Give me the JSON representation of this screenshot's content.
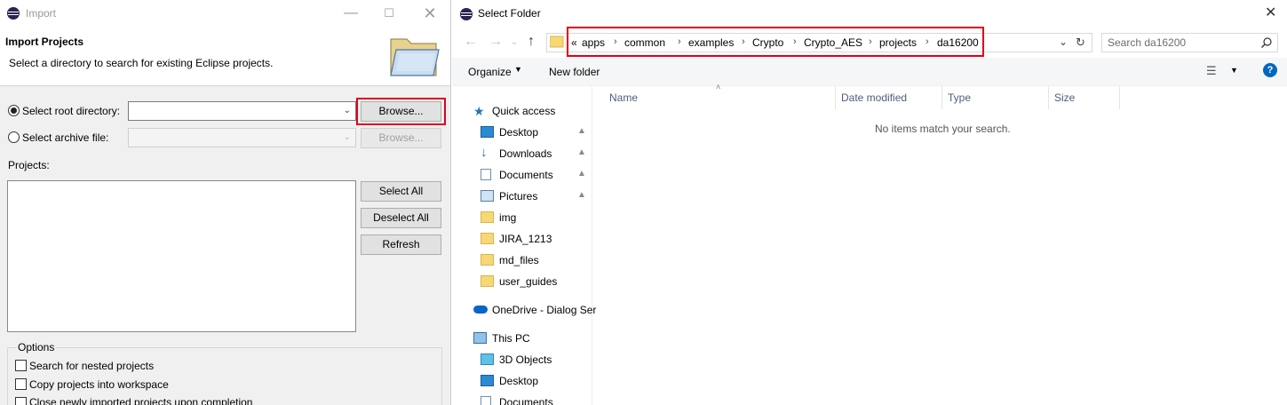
{
  "import_window": {
    "title": "Import",
    "heading": "Import Projects",
    "description": "Select a directory to search for existing Eclipse projects.",
    "root_dir_label": "Select root directory:",
    "root_dir_value": "",
    "archive_label": "Select archive file:",
    "archive_value": "",
    "browse_label": "Browse...",
    "browse_archive_label": "Browse...",
    "projects_label": "Projects:",
    "select_all_label": "Select All",
    "deselect_all_label": "Deselect All",
    "refresh_label": "Refresh",
    "options_title": "Options",
    "options": [
      "Search for nested projects",
      "Copy projects into workspace",
      "Close newly imported projects upon completion"
    ]
  },
  "folder_dialog": {
    "title": "Select Folder",
    "breadcrumb_overflow": "«",
    "breadcrumb": [
      "apps",
      "common",
      "examples",
      "Crypto",
      "Crypto_AES",
      "projects",
      "da16200"
    ],
    "search_placeholder": "Search da16200",
    "toolbar": {
      "organize": "Organize",
      "new_folder": "New folder"
    },
    "columns": [
      "Name",
      "Date modified",
      "Type",
      "Size"
    ],
    "empty_message": "No items match your search.",
    "nav": {
      "quick_access": "Quick access",
      "quick_items": [
        {
          "label": "Desktop",
          "icon": "desktop-icon",
          "pinned": true
        },
        {
          "label": "Downloads",
          "icon": "downloads-icon",
          "pinned": true
        },
        {
          "label": "Documents",
          "icon": "documents-icon",
          "pinned": true
        },
        {
          "label": "Pictures",
          "icon": "pictures-icon",
          "pinned": true
        },
        {
          "label": "img",
          "icon": "folder-synced-icon",
          "pinned": false
        },
        {
          "label": "JIRA_1213",
          "icon": "folder-icon",
          "pinned": false
        },
        {
          "label": "md_files",
          "icon": "folder-error-icon",
          "pinned": false
        },
        {
          "label": "user_guides",
          "icon": "folder-synced-icon",
          "pinned": false
        }
      ],
      "onedrive": "OneDrive - Dialog Ser",
      "this_pc": "This PC",
      "pc_items": [
        {
          "label": "3D Objects",
          "icon": "3d-objects-icon"
        },
        {
          "label": "Desktop",
          "icon": "desktop-icon"
        },
        {
          "label": "Documents",
          "icon": "documents-icon"
        }
      ]
    }
  },
  "colors": {
    "highlight": "#e0001b",
    "accent": "#0078d7",
    "folder": "#f8d775"
  }
}
